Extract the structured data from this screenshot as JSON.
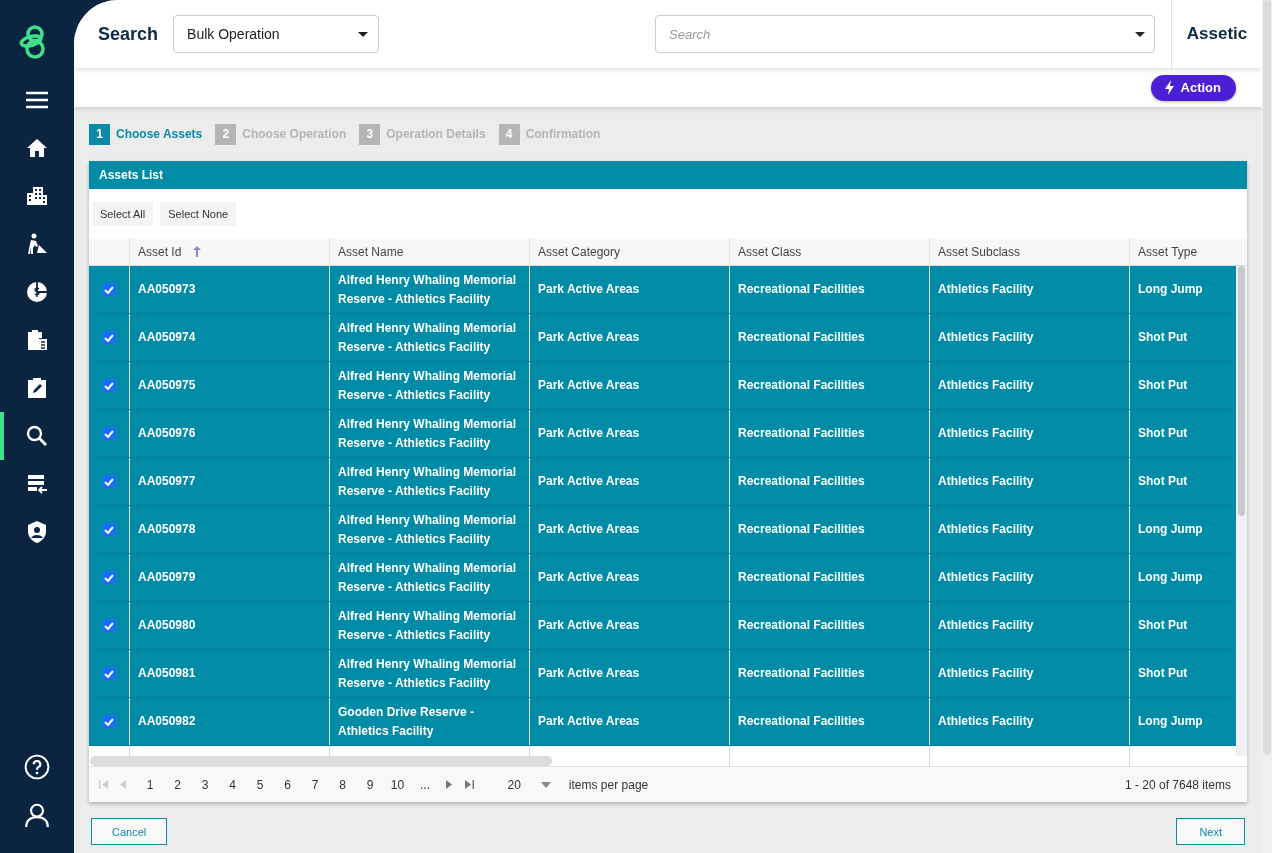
{
  "sidebar": {
    "items": [
      {
        "selected": false
      },
      {
        "selected": false
      },
      {
        "selected": false
      },
      {
        "selected": false
      },
      {
        "selected": false
      },
      {
        "selected": false
      },
      {
        "selected": false
      },
      {
        "selected": true
      },
      {
        "selected": false
      },
      {
        "selected": false
      },
      {
        "selected": false
      },
      {
        "selected": false
      }
    ]
  },
  "header": {
    "title": "Search",
    "mode_select": {
      "value": "Bulk Operation"
    },
    "search": {
      "placeholder": "Search"
    },
    "brand": "Assetic"
  },
  "action_button": "Action",
  "steps": [
    {
      "number": "1",
      "label": "Choose Assets",
      "selected": true
    },
    {
      "number": "2",
      "label": "Choose Operation",
      "selected": false
    },
    {
      "number": "3",
      "label": "Operation Details",
      "selected": false
    },
    {
      "number": "4",
      "label": "Confirmation",
      "selected": false
    }
  ],
  "panel": {
    "title": "Assets List",
    "buttons": [
      "Select All",
      "Select None"
    ]
  },
  "table": {
    "columns": [
      {
        "label": "Asset Id",
        "sorted": true
      },
      {
        "label": "Asset Name",
        "sorted": false
      },
      {
        "label": "Asset Category",
        "sorted": false
      },
      {
        "label": "Asset Class",
        "sorted": false
      },
      {
        "label": "Asset Subclass",
        "sorted": false
      },
      {
        "label": "Asset Type",
        "sorted": false
      }
    ],
    "rows": [
      {
        "selected": true,
        "cells": [
          "AA050973",
          "Alfred Henry Whaling Memorial Reserve - Athletics Facility",
          "Park Active Areas",
          "Recreational Facilities",
          "Athletics Facility",
          "Long Jump"
        ]
      },
      {
        "selected": true,
        "cells": [
          "AA050974",
          "Alfred Henry Whaling Memorial Reserve - Athletics Facility",
          "Park Active Areas",
          "Recreational Facilities",
          "Athletics Facility",
          "Shot Put"
        ]
      },
      {
        "selected": true,
        "cells": [
          "AA050975",
          "Alfred Henry Whaling Memorial Reserve - Athletics Facility",
          "Park Active Areas",
          "Recreational Facilities",
          "Athletics Facility",
          "Shot Put"
        ]
      },
      {
        "selected": true,
        "cells": [
          "AA050976",
          "Alfred Henry Whaling Memorial Reserve - Athletics Facility",
          "Park Active Areas",
          "Recreational Facilities",
          "Athletics Facility",
          "Shot Put"
        ]
      },
      {
        "selected": true,
        "cells": [
          "AA050977",
          "Alfred Henry Whaling Memorial Reserve - Athletics Facility",
          "Park Active Areas",
          "Recreational Facilities",
          "Athletics Facility",
          "Shot Put"
        ]
      },
      {
        "selected": true,
        "cells": [
          "AA050978",
          "Alfred Henry Whaling Memorial Reserve - Athletics Facility",
          "Park Active Areas",
          "Recreational Facilities",
          "Athletics Facility",
          "Long Jump"
        ]
      },
      {
        "selected": true,
        "cells": [
          "AA050979",
          "Alfred Henry Whaling Memorial Reserve - Athletics Facility",
          "Park Active Areas",
          "Recreational Facilities",
          "Athletics Facility",
          "Long Jump"
        ]
      },
      {
        "selected": true,
        "cells": [
          "AA050980",
          "Alfred Henry Whaling Memorial Reserve - Athletics Facility",
          "Park Active Areas",
          "Recreational Facilities",
          "Athletics Facility",
          "Shot Put"
        ]
      },
      {
        "selected": true,
        "cells": [
          "AA050981",
          "Alfred Henry Whaling Memorial Reserve - Athletics Facility",
          "Park Active Areas",
          "Recreational Facilities",
          "Athletics Facility",
          "Shot Put"
        ]
      },
      {
        "selected": true,
        "cells": [
          "AA050982",
          "Gooden Drive Reserve - Athletics Facility",
          "Park Active Areas",
          "Recreational Facilities",
          "Athletics Facility",
          "Long Jump"
        ]
      }
    ]
  },
  "pagination": {
    "pages": [
      "1",
      "2",
      "3",
      "4",
      "5",
      "6",
      "7",
      "8",
      "9",
      "10",
      "..."
    ],
    "per_page": "20",
    "per_page_label": "items per page",
    "summary": "1 - 20 of 7648 items"
  },
  "footer": {
    "cancel": "Cancel",
    "next": "Next"
  }
}
